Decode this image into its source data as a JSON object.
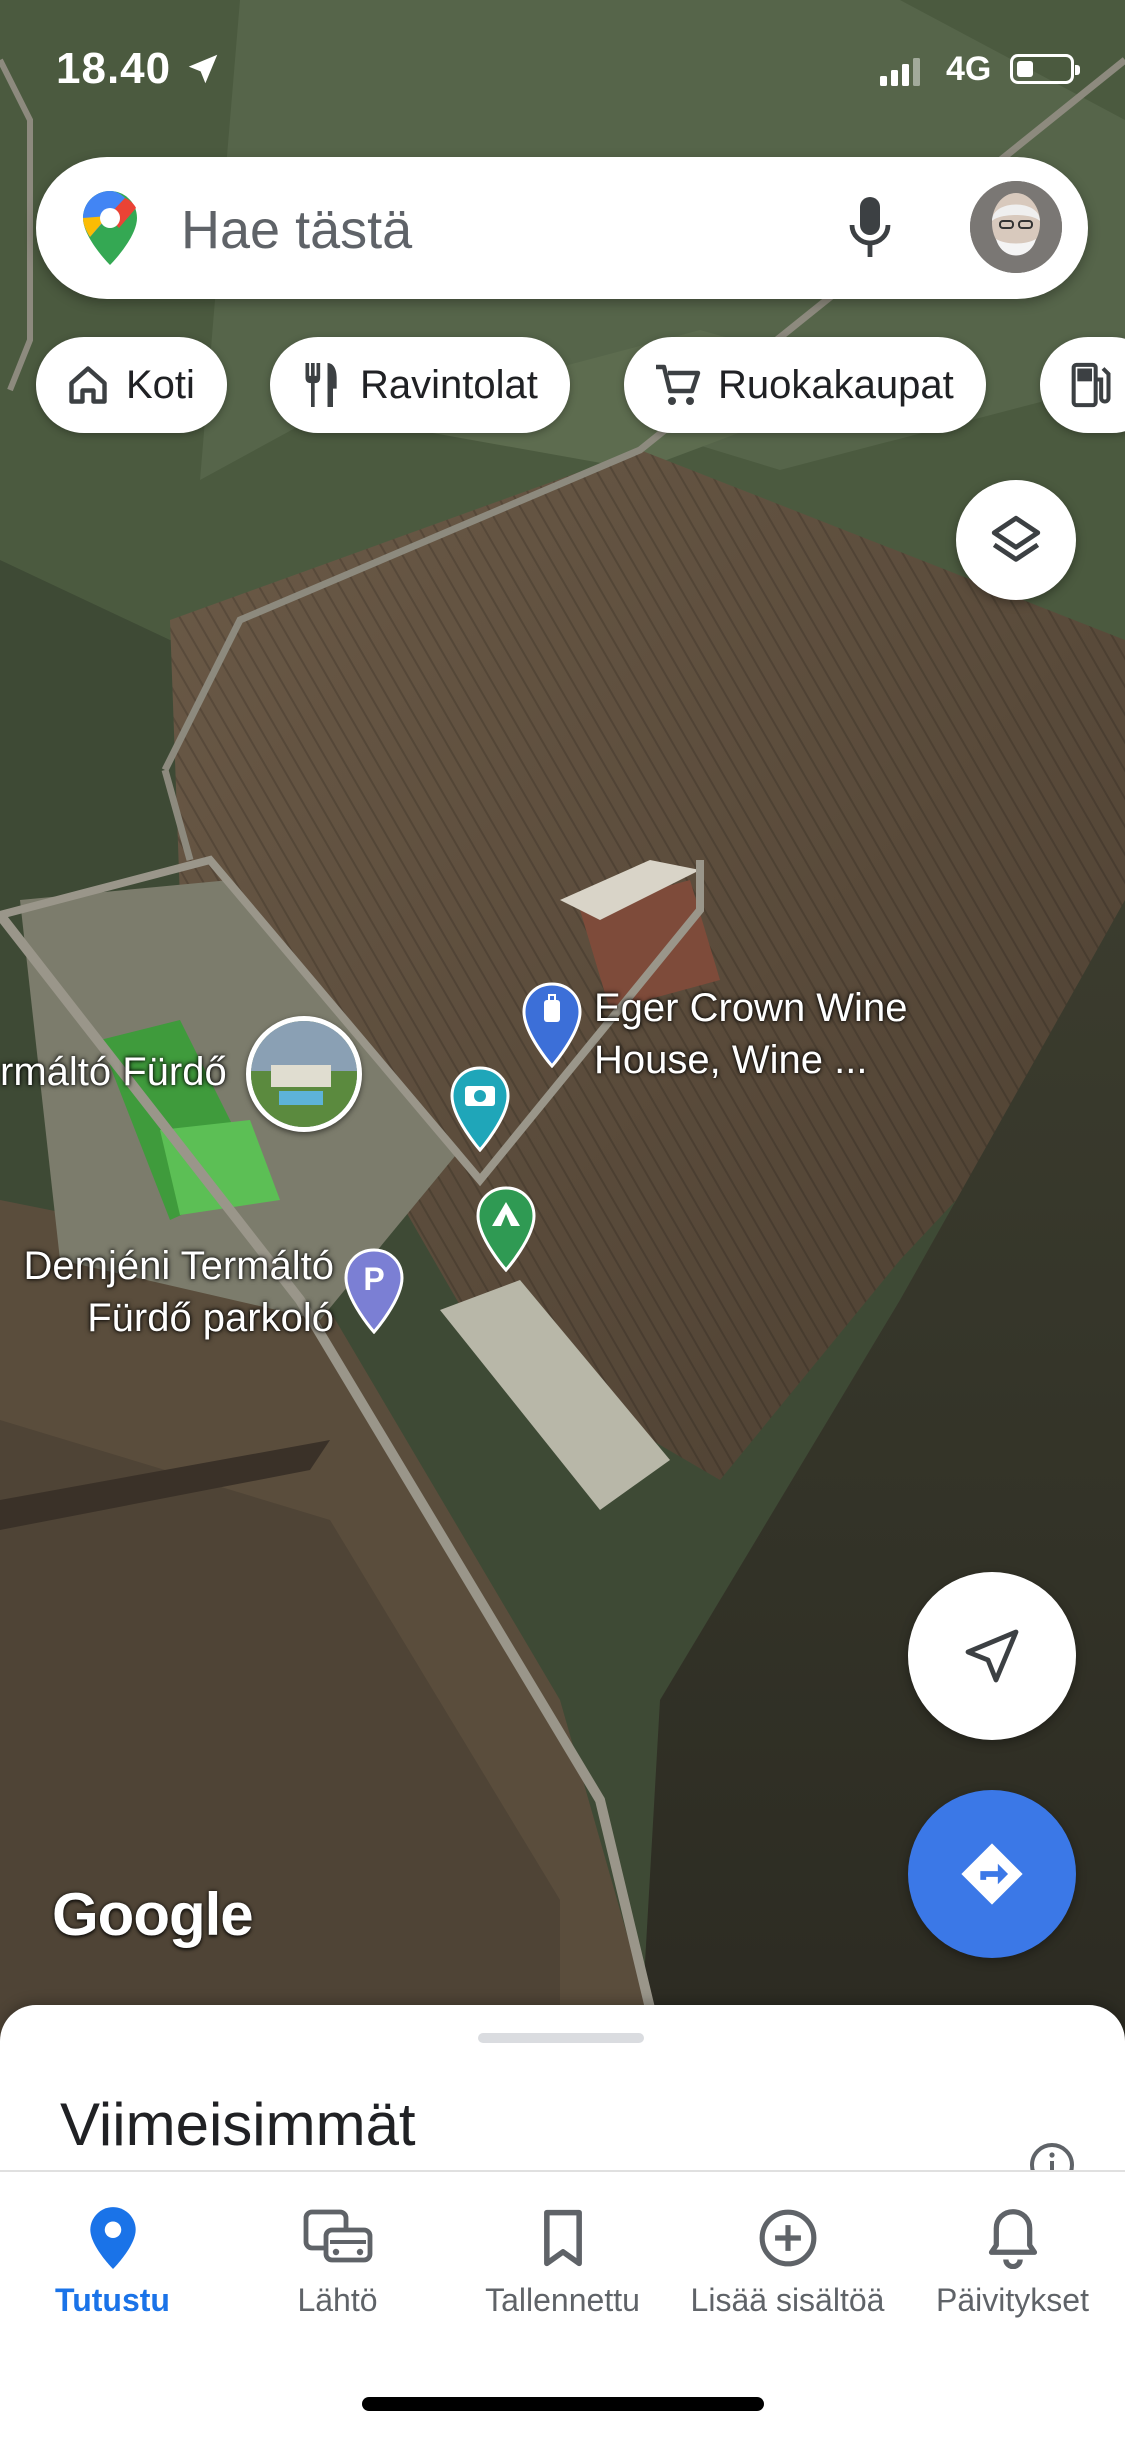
{
  "status_bar": {
    "time": "18.40",
    "network": "4G"
  },
  "search": {
    "placeholder": "Hae tästä"
  },
  "chips": [
    {
      "label": "Koti",
      "icon": "home-icon"
    },
    {
      "label": "Ravintolat",
      "icon": "restaurant-icon"
    },
    {
      "label": "Ruokakaupat",
      "icon": "cart-icon"
    },
    {
      "label": "",
      "icon": "gas-station-icon"
    }
  ],
  "map": {
    "attribution": "Google",
    "places": [
      {
        "line1": "Eger Crown Wine",
        "line2": "House, Wine ...",
        "icon": "hotel-pin-icon"
      },
      {
        "line1": "rmáltó Fürdő",
        "icon": "photo-thumbnail"
      },
      {
        "line1": "Demjéni Termáltó",
        "line2": "Fürdő parkoló",
        "icon": "parking-pin-icon"
      }
    ]
  },
  "sheet": {
    "title": "Viimeisimmät"
  },
  "bottom_nav": [
    {
      "label": "Tutustu",
      "icon": "explore-pin-icon",
      "active": true
    },
    {
      "label": "Lähtö",
      "icon": "commute-icon",
      "active": false
    },
    {
      "label": "Tallennettu",
      "icon": "bookmark-icon",
      "active": false
    },
    {
      "label": "Lisää sisältöä",
      "icon": "add-circle-icon",
      "active": false
    },
    {
      "label": "Päivitykset",
      "icon": "bell-icon",
      "active": false
    }
  ],
  "colors": {
    "accent": "#1a73e8",
    "directions": "#3b78e7"
  }
}
